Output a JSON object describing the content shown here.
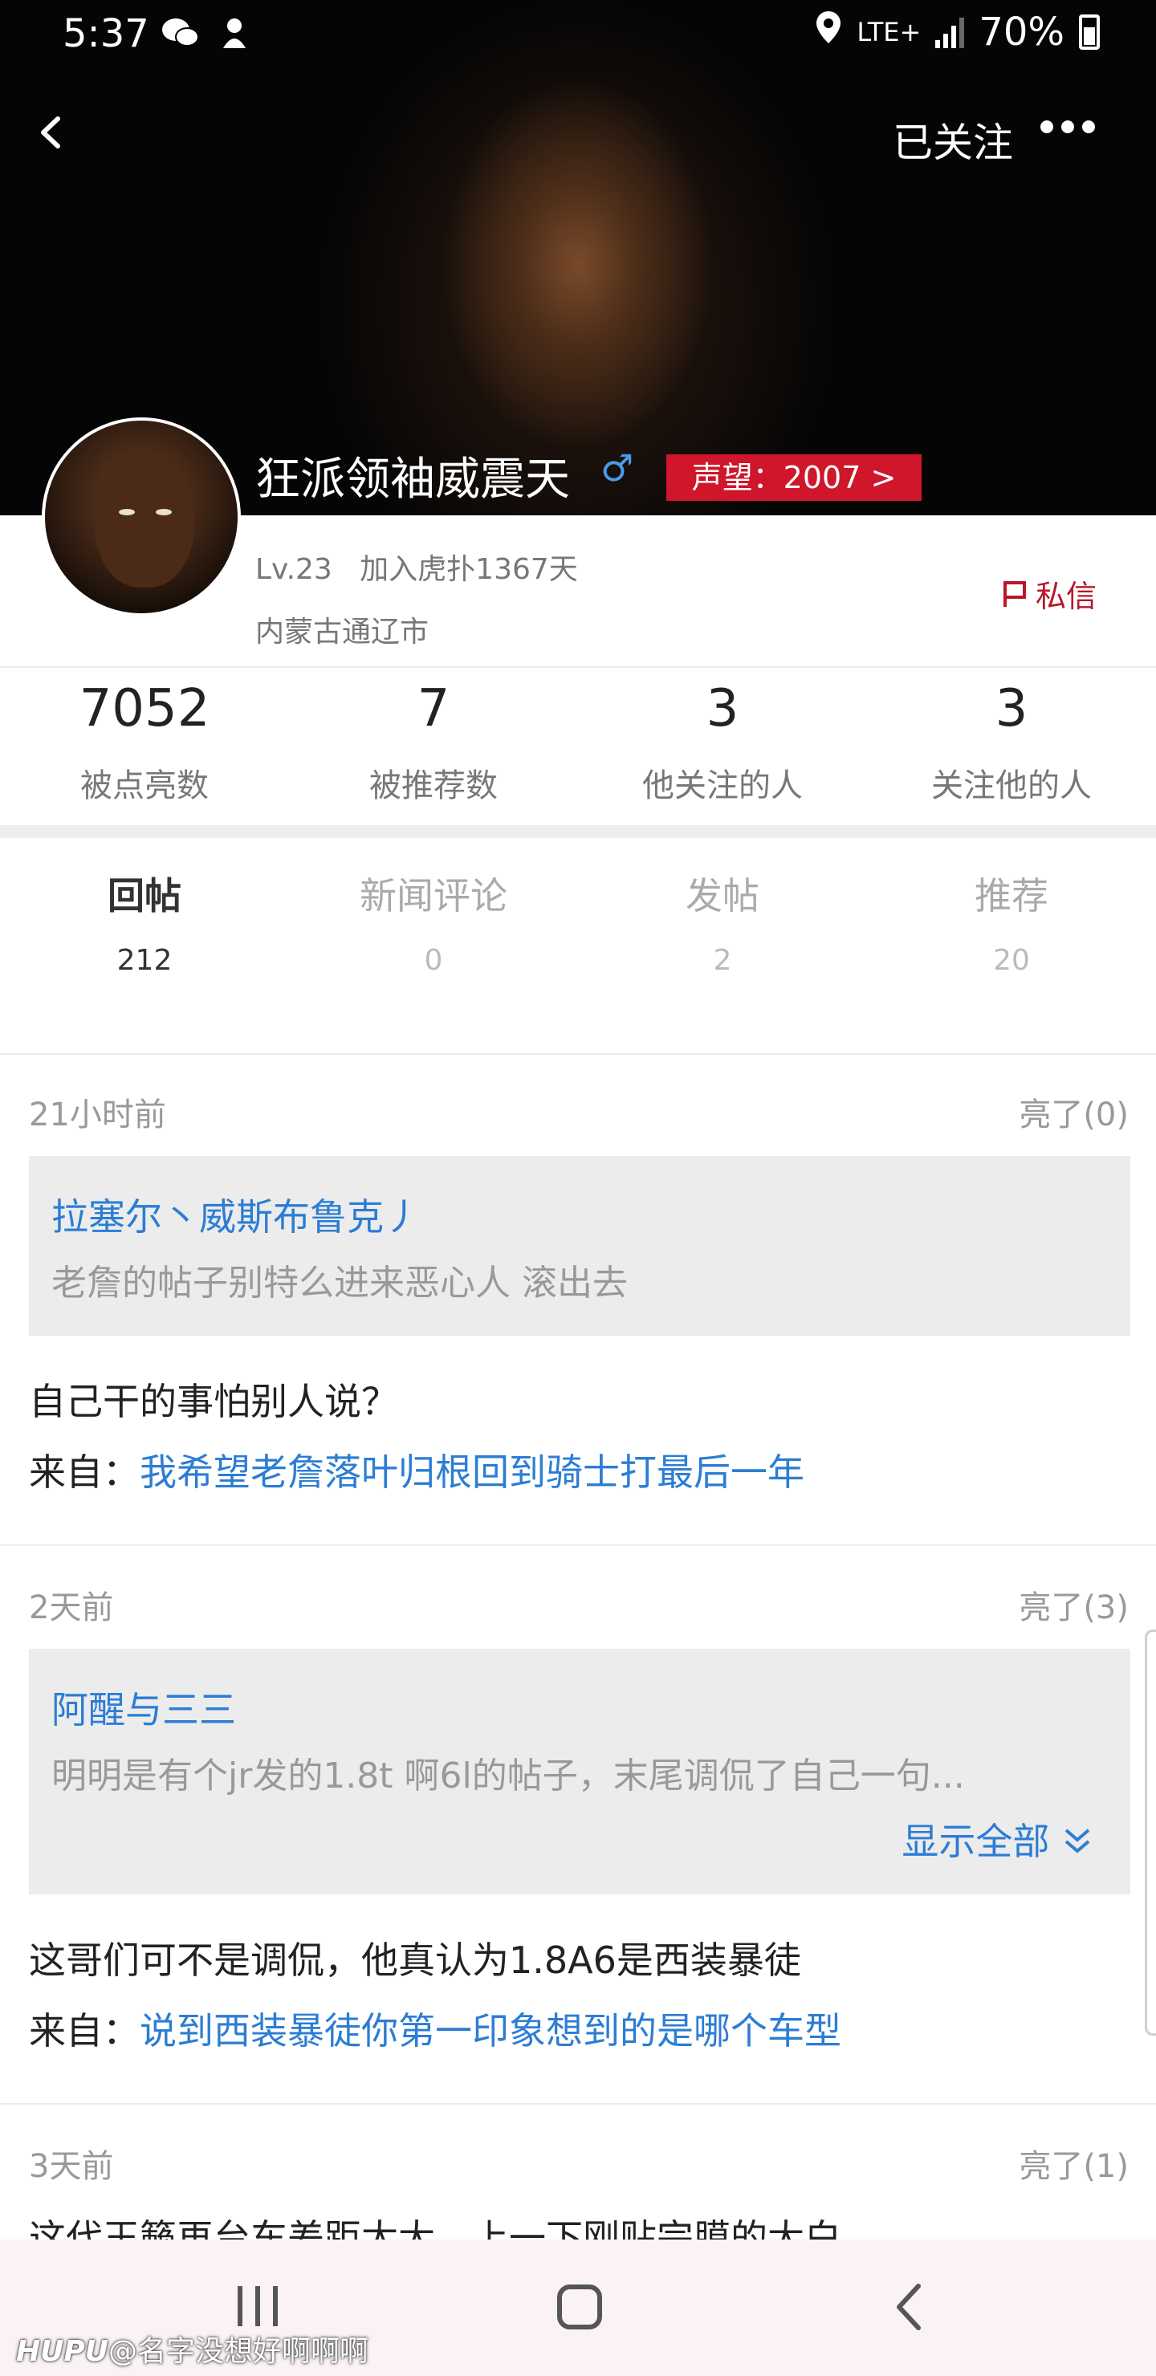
{
  "status_bar": {
    "time": "5:37",
    "network": "LTE+",
    "battery": "70%"
  },
  "header": {
    "followed_label": "已关注",
    "user_name": "狂派领袖威震天",
    "gender_symbol": "♂",
    "reputation_label": "声望：2007 >",
    "level": "Lv.23",
    "joined": "加入虎扑1367天",
    "location": "内蒙古通辽市",
    "message_label": "私信"
  },
  "stats": [
    {
      "value": "7052",
      "label": "被点亮数"
    },
    {
      "value": "7",
      "label": "被推荐数"
    },
    {
      "value": "3",
      "label": "他关注的人"
    },
    {
      "value": "3",
      "label": "关注他的人"
    }
  ],
  "tabs": [
    {
      "label": "回帖",
      "count": "212"
    },
    {
      "label": "新闻评论",
      "count": "0"
    },
    {
      "label": "发帖",
      "count": "2"
    },
    {
      "label": "推荐",
      "count": "20"
    }
  ],
  "posts": [
    {
      "time": "21小时前",
      "likes": "亮了(0)",
      "quote_author": "拉塞尔丶威斯布鲁克丿",
      "quote_text": "老詹的帖子别特么进来恶心人 滚出去",
      "reply": "自己干的事怕别人说？",
      "from_label": "来自：",
      "from_link": "我希望老詹落叶归根回到骑士打最后一年"
    },
    {
      "time": "2天前",
      "likes": "亮了(3)",
      "quote_author": "阿醒与三三",
      "quote_text": "明明是有个jr发的1.8t 啊6l的帖子，末尾调侃了自己一句...",
      "show_all": "显示全部",
      "reply": "这哥们可不是调侃，他真认为1.8A6是西装暴徒",
      "from_label": "来自：",
      "from_link": "说到西装暴徒你第一印象想到的是哪个车型"
    },
    {
      "time": "3天前",
      "likes": "亮了(1)",
      "partial_text": "这代王籁再台车差距太大，上一下刚贴完膜的大白"
    }
  ],
  "watermark": {
    "brand": "HUPU",
    "text": "@名字没想好啊啊啊"
  }
}
